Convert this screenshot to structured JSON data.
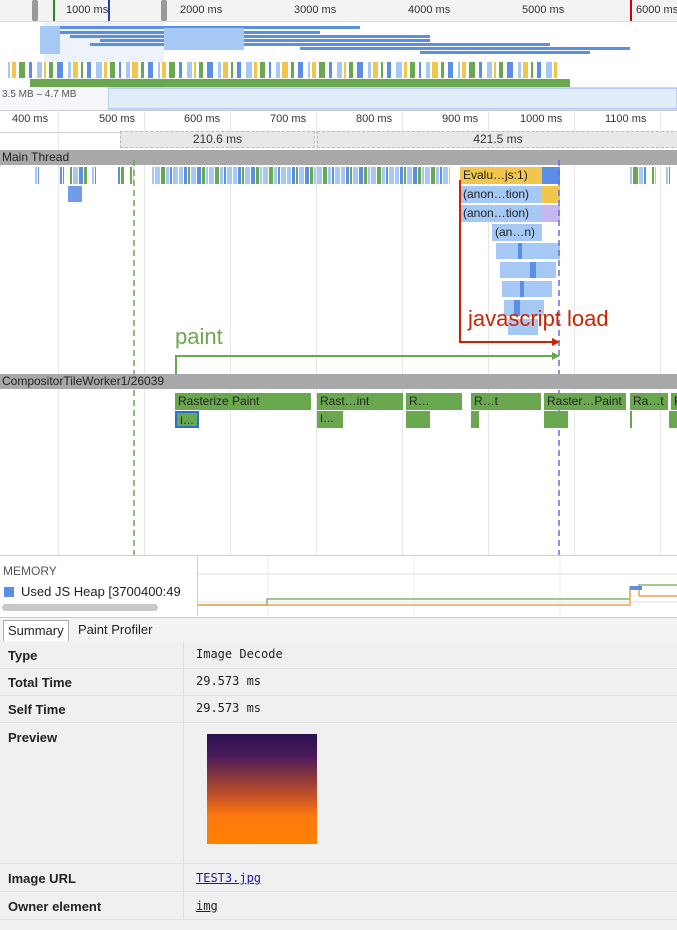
{
  "overview": {
    "ruler_ticks": [
      "1000 ms",
      "2000 ms",
      "3000 ms",
      "4000 ms",
      "5000 ms",
      "6000 ms"
    ],
    "memory_range": "3.5 MB – 4.7 MB"
  },
  "main_ruler": {
    "ticks": [
      "400 ms",
      "500 ms",
      "600 ms",
      "700 ms",
      "800 ms",
      "900 ms",
      "1000 ms",
      "1100 ms"
    ]
  },
  "frames": [
    "210.6 ms",
    "421.5 ms"
  ],
  "main_thread": {
    "title": "Main Thread",
    "stack": [
      "Evalu…js:1)",
      "(anon…tion)",
      "(anon…tion)",
      "(an…n)"
    ]
  },
  "annotations": {
    "paint": "paint",
    "javascript_load": "javascript load",
    "paint_color": "#6aa84f",
    "js_color": "#cc2200"
  },
  "compositor": {
    "title": "CompositorTileWorker1/26039",
    "tasks": [
      "Rasterize Paint",
      "Rast…int",
      "R…",
      "R…t",
      "Raster…Paint",
      "Ra…t",
      "R"
    ],
    "subtasks": [
      "I…",
      "I…"
    ]
  },
  "memory": {
    "title": "MEMORY",
    "legend": "Used JS Heap [3700400:49"
  },
  "tabs": [
    "Summary",
    "Paint Profiler"
  ],
  "details": {
    "type_label": "Type",
    "type_value": "Image Decode",
    "total_label": "Total Time",
    "total_value": "29.573 ms",
    "self_label": "Self Time",
    "self_value": "29.573 ms",
    "preview_label": "Preview",
    "url_label": "Image URL",
    "url_value": "TEST3.jpg",
    "owner_label": "Owner element",
    "owner_value": "img"
  },
  "colors": {
    "script": "#f2c64c",
    "render": "#a6c8f5",
    "paint": "#6aa84f",
    "loading": "#5b8ee6",
    "preview_top": "#2a1152",
    "preview_bottom": "#ff8000"
  }
}
